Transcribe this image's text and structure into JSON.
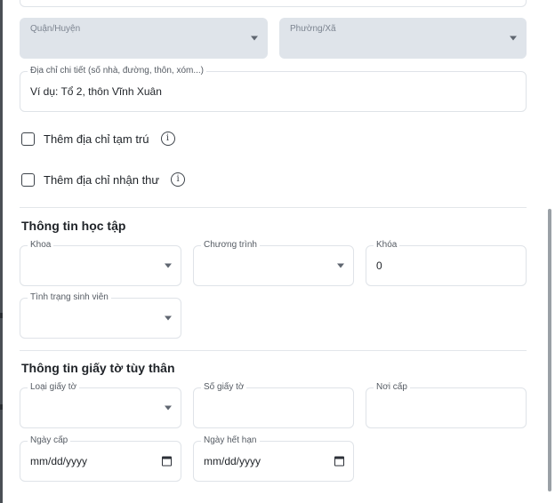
{
  "address": {
    "district": {
      "label": "Quận/Huyện"
    },
    "ward": {
      "label": "Phường/Xã"
    },
    "detail": {
      "label": "Địa chỉ chi tiết (số nhà, đường, thôn, xóm...)",
      "placeholder": "Ví dụ: Tổ 2, thôn Vĩnh Xuân"
    },
    "temporary_address_checkbox": "Thêm địa chỉ tạm trú",
    "mailing_address_checkbox": "Thêm địa chỉ nhận thư"
  },
  "study_info": {
    "title": "Thông tin học tập",
    "faculty": {
      "label": "Khoa",
      "value": ""
    },
    "program": {
      "label": "Chương trình",
      "value": ""
    },
    "cohort": {
      "label": "Khóa",
      "value": "0"
    },
    "student_status": {
      "label": "Tình trạng sinh viên",
      "value": ""
    }
  },
  "id_documents": {
    "title": "Thông tin giấy tờ tùy thân",
    "doc_type": {
      "label": "Loại giấy tờ",
      "value": ""
    },
    "doc_number": {
      "label": "Số giấy tờ",
      "value": ""
    },
    "issued_place": {
      "label": "Nơi cấp",
      "value": ""
    },
    "issued_date": {
      "label": "Ngày cấp",
      "placeholder": "mm/dd/yyyy"
    },
    "expiry_date": {
      "label": "Ngày hết hạn",
      "placeholder": "mm/dd/yyyy"
    }
  },
  "icons": {
    "info": "info-circle-icon",
    "caret": "chevron-down-icon",
    "calendar": "calendar-icon"
  }
}
